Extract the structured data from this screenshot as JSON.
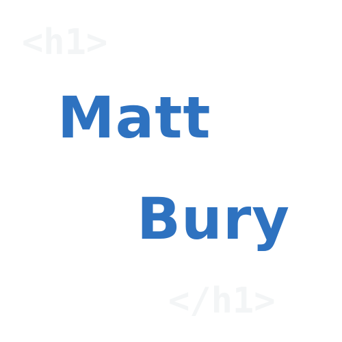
{
  "decor": {
    "open_tag": "<h1>",
    "close_tag": "</h1>",
    "color": "#f3f5f6"
  },
  "name": {
    "first": "Matt",
    "last": "Bury",
    "color": "#2e72c0"
  }
}
